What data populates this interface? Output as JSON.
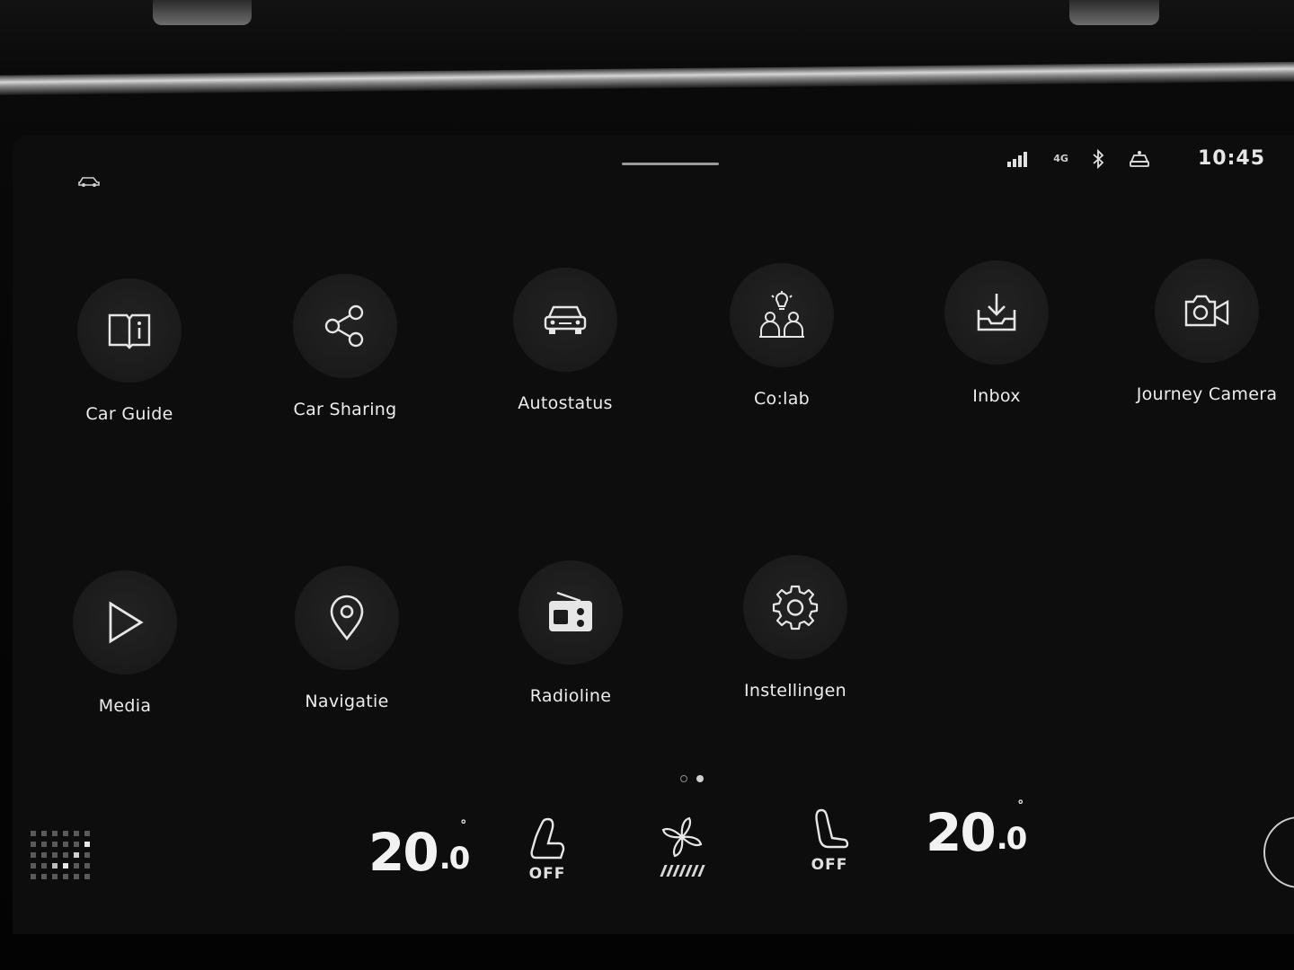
{
  "status": {
    "network": "4G",
    "time": "10:45"
  },
  "apps": [
    {
      "id": "car-guide",
      "label": "Car Guide",
      "icon": "book-icon"
    },
    {
      "id": "car-sharing",
      "label": "Car Sharing",
      "icon": "share-icon"
    },
    {
      "id": "autostatus",
      "label": "Autostatus",
      "icon": "car-front-icon"
    },
    {
      "id": "colab",
      "label": "Co:lab",
      "icon": "people-idea-icon"
    },
    {
      "id": "inbox",
      "label": "Inbox",
      "icon": "inbox-download-icon"
    },
    {
      "id": "journey-camera",
      "label": "Journey Camera",
      "icon": "camera-icon"
    },
    {
      "id": "media",
      "label": "Media",
      "icon": "play-icon"
    },
    {
      "id": "navigatie",
      "label": "Navigatie",
      "icon": "location-pin-icon"
    },
    {
      "id": "radioline",
      "label": "Radioline",
      "icon": "radio-icon"
    },
    {
      "id": "instellingen",
      "label": "Instellingen",
      "icon": "gear-icon"
    }
  ],
  "pager": {
    "total": 2,
    "active": 2
  },
  "climate": {
    "left_temp": {
      "whole": "20",
      "decimal": ".0",
      "unit": "°"
    },
    "right_temp": {
      "whole": "20",
      "decimal": ".0",
      "unit": "°"
    },
    "left_seat_label": "OFF",
    "right_seat_label": "OFF",
    "fan_level": 7,
    "fan_max": 7
  },
  "colors": {
    "background": "#0d0d0d",
    "tile": "#1b1b1b",
    "text": "#ededed"
  }
}
